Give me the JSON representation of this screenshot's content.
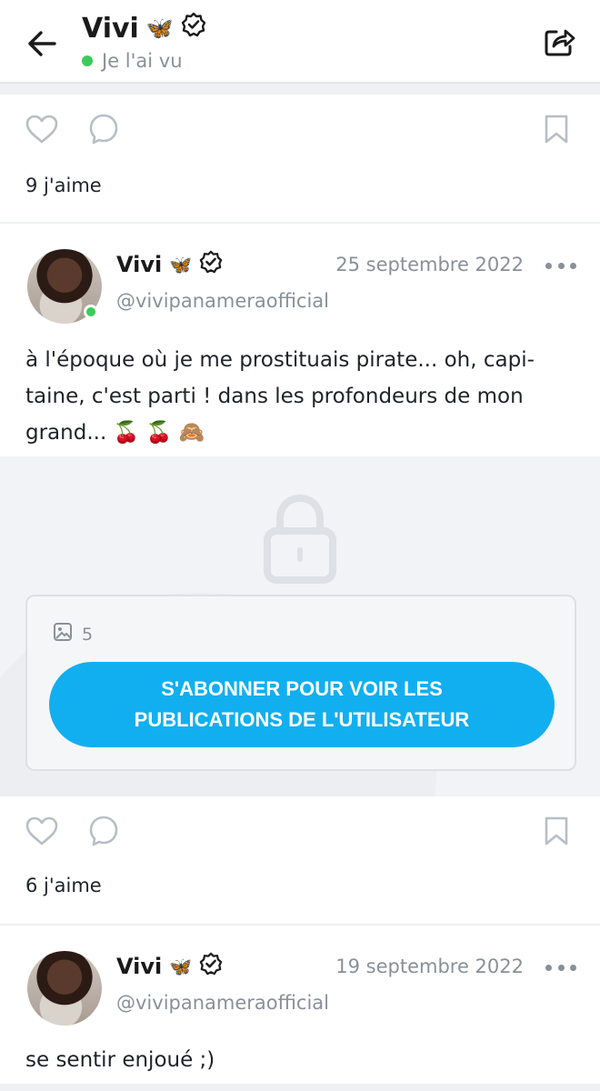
{
  "header": {
    "name": "Vivi",
    "name_emoji": "🦋",
    "status": "Je l'ai vu"
  },
  "post1": {
    "likes": "9 j'aime"
  },
  "post2": {
    "name": "Vivi",
    "name_emoji": "🦋",
    "handle": "@vivipanameraofficial",
    "date": "25 septembre 2022",
    "text": "à l'époque où je me prostituais pirate... oh, capi-taine, c'est parti ! dans les profondeurs de mon grand... 🍒 🍒 🙈",
    "media_count": "5",
    "subscribe_label": "S'ABONNER POUR VOIR LES PUBLICATIONS DE L'UTILISATEUR",
    "likes": "6 j'aime"
  },
  "post3": {
    "name": "Vivi",
    "name_emoji": "🦋",
    "handle": "@vivipanameraofficial",
    "date": "19 septembre 2022",
    "text": "se sentir enjoué ;)"
  },
  "colors": {
    "accent": "#12aff0",
    "online": "#3ccb5a",
    "muted": "#8a9099"
  }
}
